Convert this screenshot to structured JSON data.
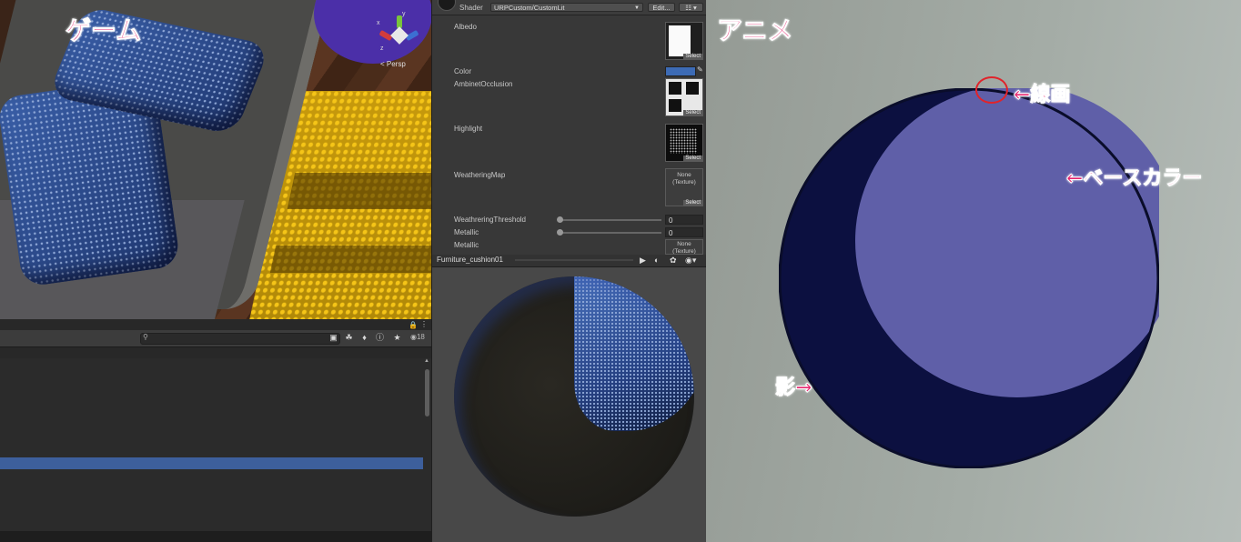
{
  "game": {
    "title": "ゲーム",
    "gizmo": {
      "x": "x",
      "y": "y",
      "z": "z",
      "projection": "< Persp"
    }
  },
  "console": {
    "search": {
      "placeholder": "",
      "icon": "search-icon"
    },
    "hidden_count": "18"
  },
  "inspector": {
    "shader_label": "Shader",
    "shader_value": "URPCustom/CustomLit",
    "edit_button": "Edit...",
    "properties": {
      "albedo": "Albedo",
      "color": "Color",
      "ambient_occlusion": "AmbinetOcclusion",
      "highlight": "Highlight",
      "weathering_map": "WeatheringMap",
      "weathering_threshold": "WeathreringThreshold",
      "metallic": "Metallic",
      "metallic_map": "Metallic"
    },
    "select_label": "Select",
    "none_texture": "None\n(Texture)",
    "weathering_threshold_value": "0",
    "metallic_value": "0",
    "color_value": "#3d6bb5"
  },
  "preview": {
    "object_name": "Furniture_cushion01"
  },
  "anime": {
    "title": "アニメ",
    "annotations": {
      "line_art": "←線画",
      "base_color": "←ベースカラー",
      "shadow": "影→"
    },
    "colors": {
      "base": "#5f5fa8",
      "shadow": "#0c1040",
      "background": "#a4aca6"
    }
  }
}
